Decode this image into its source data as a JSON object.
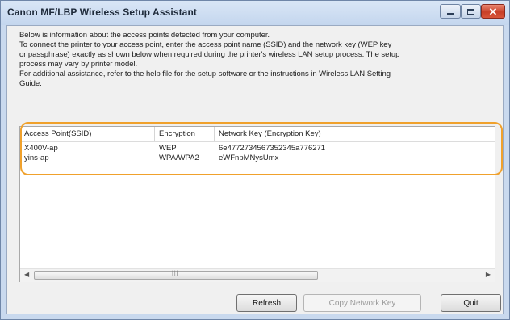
{
  "window": {
    "title": "Canon MF/LBP Wireless Setup Assistant"
  },
  "description": [
    "Below is information about the access points detected from your computer.",
    "To connect the printer to your access point, enter the access point name (SSID) and the network key (WEP key",
    "or passphrase) exactly as shown below when required during the printer's wireless LAN setup process. The setup",
    "process may vary by printer model.",
    "For additional assistance, refer to the help file for the setup software or the instructions in Wireless LAN Setting",
    "Guide."
  ],
  "table": {
    "columns": [
      "Access Point(SSID)",
      "Encryption",
      "Network Key (Encryption Key)"
    ],
    "rows": [
      [
        "X400V-ap",
        "WEP",
        "6e4772734567352345a776271"
      ],
      [
        "yins-ap",
        "WPA/WPA2",
        "eWFnpMNysUmx"
      ]
    ]
  },
  "buttons": {
    "refresh": "Refresh",
    "copy_key": "Copy Network Key",
    "quit": "Quit"
  },
  "icons": {
    "minimize": "minimize-icon",
    "maximize": "maximize-icon",
    "close": "close-icon",
    "scroll_left": "scroll-left-arrow-icon",
    "scroll_right": "scroll-right-arrow-icon"
  },
  "colors": {
    "highlight": "#f0a12c",
    "title_bar": "#c9d9ee",
    "close_button": "#c84028"
  }
}
